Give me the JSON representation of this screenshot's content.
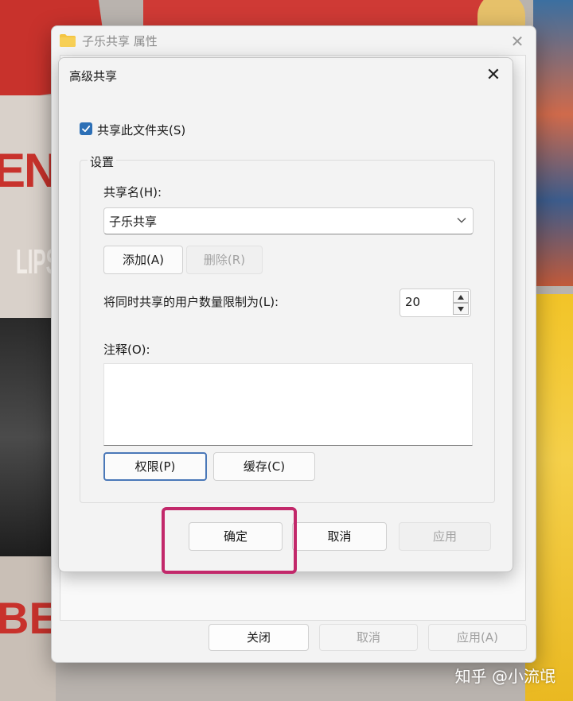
{
  "properties_window": {
    "title": "子乐共享 属性",
    "close_glyph": "✕",
    "buttons": {
      "close": "关闭",
      "cancel": "取消",
      "apply": "应用(A)"
    }
  },
  "advanced_sharing": {
    "title": "高级共享",
    "close_glyph": "✕",
    "share_checkbox": {
      "label": "共享此文件夹(S)",
      "checked": true
    },
    "settings": {
      "legend": "设置",
      "share_name_label": "共享名(H):",
      "share_name_value": "子乐共享",
      "add_button": "添加(A)",
      "remove_button": "删除(R)",
      "user_limit_label": "将同时共享的用户数量限制为(L):",
      "user_limit_value": "20",
      "comment_label": "注释(O):",
      "comment_value": "",
      "permissions_button": "权限(P)",
      "caching_button": "缓存(C)"
    },
    "buttons": {
      "ok": "确定",
      "cancel": "取消",
      "apply": "应用"
    }
  },
  "wallpaper": {
    "text_en": "EN",
    "text_lips": "LIPS",
    "text_be": "BE"
  },
  "watermark": "知乎 @小流氓",
  "colors": {
    "accent": "#2c6fb6",
    "highlight": "#c2286a",
    "folder": "#f4c542"
  }
}
